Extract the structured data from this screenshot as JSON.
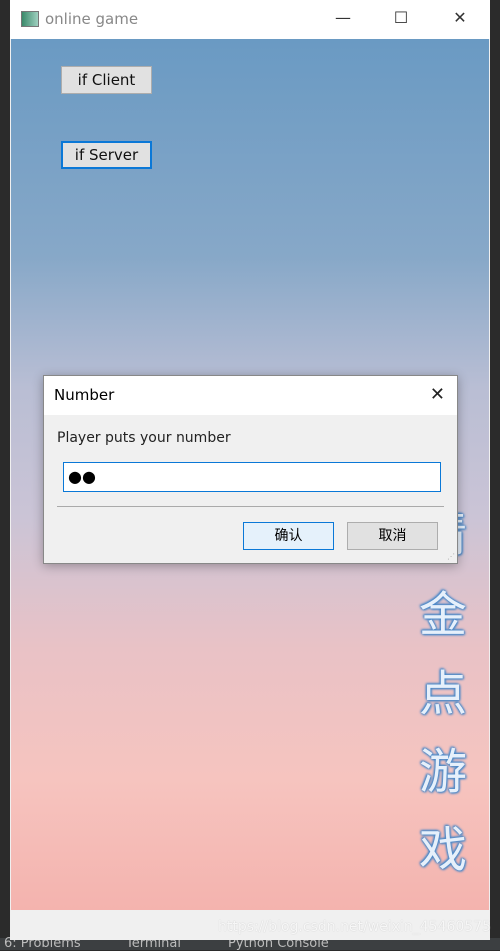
{
  "window": {
    "title": "online game",
    "minimize": "—",
    "maximize": "☐",
    "close": "✕"
  },
  "buttons": {
    "client": "if Client",
    "server": "if Server"
  },
  "vertical_title": [
    "猜",
    "金",
    "点",
    "游",
    "戏"
  ],
  "dialog": {
    "title": "Number",
    "close": "✕",
    "label": "Player  puts your number",
    "input_value": "●●",
    "ok": "确认",
    "cancel": "取消"
  },
  "watermark": "https://blog.csdn.net/weixin_45460575",
  "ide_tabs": [
    "6: Problems",
    "Terminal",
    "Python Console"
  ]
}
